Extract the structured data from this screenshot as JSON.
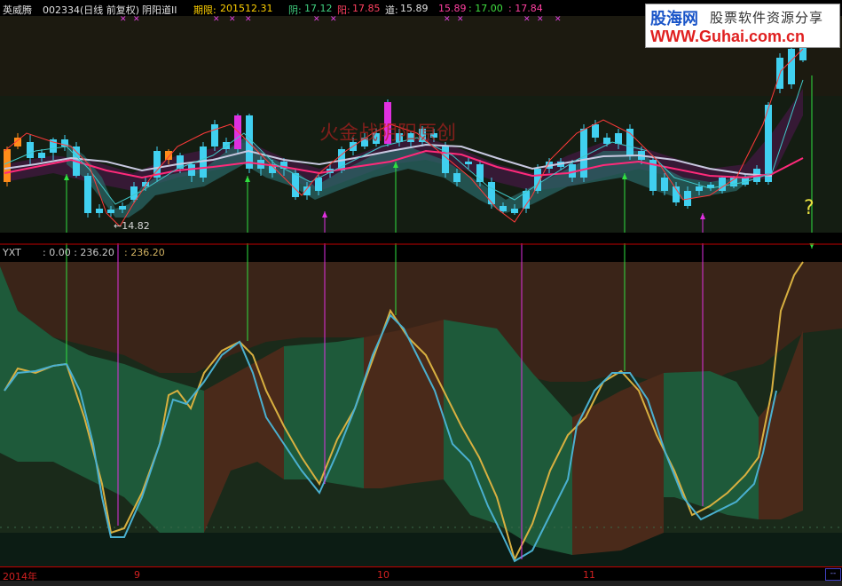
{
  "header": {
    "stock_name": "英威腾",
    "stock_code_period": "002334(日线 前复权)",
    "indicator_name": "阴阳道II",
    "period_label": "期限:",
    "period_value": "201512.31",
    "yin_label": "阴:",
    "yin_value": "17.12",
    "yang_label": "阳:",
    "yang_value": "17.85",
    "dao_label": "道:",
    "dao_value": "15.89",
    "v4": "15.89",
    "v5": ": 17.00",
    "v6": ": 17.84"
  },
  "logo": {
    "line1": "股海网",
    "line2": "股票软件资源分享",
    "line3": "WWW.Guhai.com.cn"
  },
  "watermark": "火金战阴阳原创",
  "price_panel": {
    "low_marker": "←14.82",
    "question_mark": "?"
  },
  "sub_panel": {
    "name": "YXT",
    "values": ": 0.00 : 236.20",
    "value2": ": 236.20"
  },
  "x_axis": {
    "year_label": "2014年",
    "ticks": [
      "9",
      "10",
      "11"
    ]
  },
  "corner_button": "--",
  "colors": {
    "candle_up": "#ff8c1a",
    "candle_down": "#40d0f0",
    "ma_pink": "#ff2a7a",
    "ma_white": "#c8c8e0",
    "band_teal": "#2a6a6a",
    "band_purple": "#4a1a4a",
    "osc_yellow": "#d8b040",
    "osc_blue": "#4ab0d0",
    "fill_green": "#1e5a3a",
    "fill_brown": "#4a2a1a",
    "arrow_green": "#30e040",
    "arrow_magenta": "#e030e0"
  }
}
